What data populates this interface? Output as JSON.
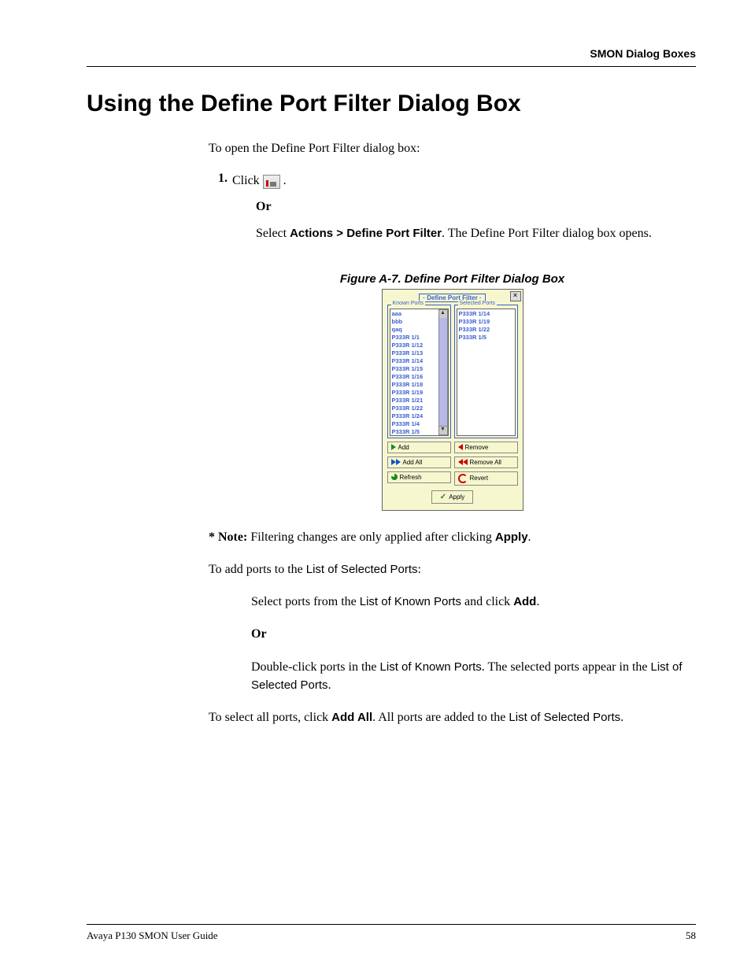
{
  "header": {
    "section": "SMON Dialog Boxes"
  },
  "title": "Using the Define Port Filter Dialog Box",
  "intro": "To open the Define Port Filter dialog box:",
  "step1": {
    "num": "1.",
    "click": "Click ",
    "period": ".",
    "or": "Or",
    "select_pre": "Select ",
    "select_bold": "Actions > Define Port Filter",
    "select_post": ". The Define Port Filter dialog box opens."
  },
  "figure": {
    "caption": "Figure A-7.  Define Port Filter Dialog Box",
    "dialog_title": "· Define Port Filter ·",
    "known_label": "Known Ports",
    "selected_label": "Selected Ports",
    "known_ports": [
      "aaa",
      "bbb",
      "qaq",
      "P333R 1/1",
      "P333R 1/12",
      "P333R 1/13",
      "P333R 1/14",
      "P333R 1/15",
      "P333R 1/16",
      "P333R 1/18",
      "P333R 1/19",
      "P333R 1/21",
      "P333R 1/22",
      "P333R 1/24",
      "P333R 1/4",
      "P333R 1/5"
    ],
    "selected_ports": [
      "P333R 1/14",
      "P333R 1/19",
      "P333R 1/22",
      "P333R 1/5"
    ],
    "btn_add": "Add",
    "btn_addall": "Add All",
    "btn_refresh": "Refresh",
    "btn_remove": "Remove",
    "btn_removeall": "Remove All",
    "btn_revert": "Revert",
    "btn_apply": "Apply"
  },
  "note": {
    "star": "* Note:",
    "text": "  Filtering changes are only applied after clicking ",
    "apply": "Apply",
    "end": "."
  },
  "add_intro_pre": "To add ports to the ",
  "add_intro_ui": "List of Selected Ports",
  "add_intro_post": ":",
  "add1_pre": "Select ports from the ",
  "add1_ui": "List of Known Ports",
  "add1_mid": " and click ",
  "add1_bold": "Add",
  "add1_end": ".",
  "or2": "Or",
  "add2_pre": "Double-click ports in the ",
  "add2_ui1": "List of Known Ports",
  "add2_mid": ". The selected ports appear in the ",
  "add2_ui2": "List of Selected Ports",
  "add2_end": ".",
  "all_pre": "To select all ports, click ",
  "all_bold": "Add All",
  "all_mid": ". All ports are added to the ",
  "all_ui": "List of Selected Ports",
  "all_end": ".",
  "footer": {
    "left": "Avaya P130 SMON User Guide",
    "right": "58"
  }
}
